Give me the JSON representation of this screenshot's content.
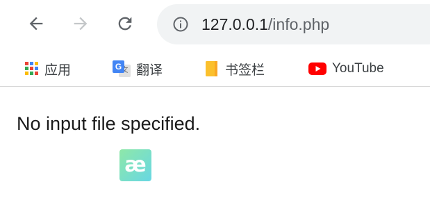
{
  "address_bar": {
    "host": "127.0.0.1",
    "path": "/info.php"
  },
  "icons": {
    "back": "back-arrow-icon",
    "forward": "forward-arrow-icon",
    "reload": "reload-icon",
    "info": "info-icon"
  },
  "bookmarks": [
    {
      "label": "应用",
      "icon": "apps-grid-icon"
    },
    {
      "label": "翻译",
      "icon": "google-translate-icon"
    },
    {
      "label": "书签栏",
      "icon": "folder-icon"
    },
    {
      "label": "YouTube",
      "icon": "youtube-icon"
    }
  ],
  "page": {
    "message": "No input file specified.",
    "badge": "æ"
  },
  "colors": {
    "nav_active": "#5f6368",
    "nav_disabled": "#c4c7c9",
    "omnibox_bg": "#f1f3f4",
    "youtube_red": "#ff0000",
    "folder_yellow": "#fbc02d",
    "translate_blue": "#4285f4"
  }
}
